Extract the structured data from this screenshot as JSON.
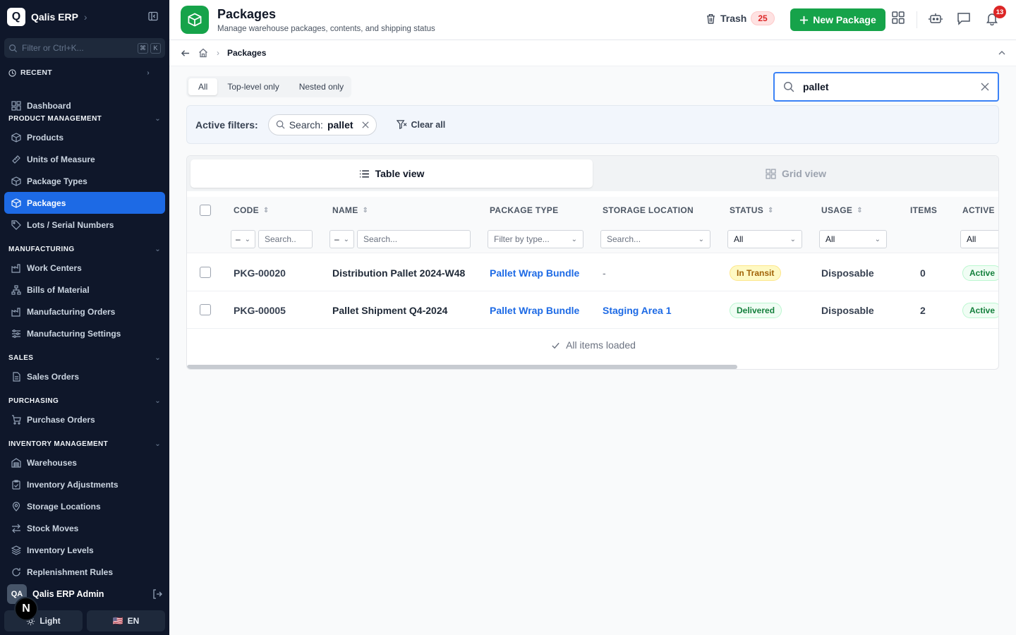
{
  "app": {
    "logo_letter": "Q",
    "name": "Qalis ERP"
  },
  "sidebar": {
    "search_placeholder": "Filter or Ctrl+K...",
    "kbd": [
      "⌘",
      "K"
    ],
    "recent_label": "RECENT",
    "dashboard": "Dashboard",
    "sections": [
      {
        "title": "PRODUCT MANAGEMENT",
        "items": [
          "Products",
          "Units of Measure",
          "Package Types",
          "Packages",
          "Lots / Serial Numbers"
        ]
      },
      {
        "title": "MANUFACTURING",
        "items": [
          "Work Centers",
          "Bills of Material",
          "Manufacturing Orders",
          "Manufacturing Settings"
        ]
      },
      {
        "title": "SALES",
        "items": [
          "Sales Orders"
        ]
      },
      {
        "title": "PURCHASING",
        "items": [
          "Purchase Orders"
        ]
      },
      {
        "title": "INVENTORY MANAGEMENT",
        "items": [
          "Warehouses",
          "Inventory Adjustments",
          "Storage Locations",
          "Stock Moves",
          "Inventory Levels",
          "Replenishment Rules"
        ]
      }
    ],
    "active_item": "Packages",
    "user": {
      "initials": "QA",
      "name": "Qalis ERP Admin"
    },
    "theme_label": "Light",
    "lang_label": "EN",
    "lang_flag": "🇺🇸",
    "nbadge": "N"
  },
  "header": {
    "title": "Packages",
    "subtitle": "Manage warehouse packages, contents, and shipping status",
    "trash_label": "Trash",
    "trash_count": "25",
    "new_button": "New Package",
    "notif_count": "13"
  },
  "breadcrumb": {
    "current": "Packages"
  },
  "tabs": [
    {
      "label": "All",
      "active": true
    },
    {
      "label": "Top-level only"
    },
    {
      "label": "Nested only"
    }
  ],
  "search": {
    "value": "pallet"
  },
  "filters": {
    "label": "Active filters:",
    "chip_key": "Search:",
    "chip_value": "pallet",
    "clear_label": "Clear all"
  },
  "view_tabs": {
    "table": "Table view",
    "grid": "Grid view"
  },
  "table": {
    "columns": [
      "CODE",
      "NAME",
      "PACKAGE TYPE",
      "STORAGE LOCATION",
      "STATUS",
      "USAGE",
      "ITEMS",
      "ACTIVE"
    ],
    "filters": {
      "code_op": "–",
      "code_placeholder": "Search..",
      "name_op": "–",
      "name_placeholder": "Search...",
      "type_placeholder": "Filter by type...",
      "location_placeholder": "Search...",
      "status_value": "All",
      "usage_value": "All",
      "active_value": "All"
    },
    "rows": [
      {
        "code": "PKG-00020",
        "name": "Distribution Pallet 2024-W48",
        "type": "Pallet Wrap Bundle",
        "location": "-",
        "status": "In Transit",
        "usage": "Disposable",
        "items": "0",
        "active": "Active"
      },
      {
        "code": "PKG-00005",
        "name": "Pallet Shipment Q4-2024",
        "type": "Pallet Wrap Bundle",
        "location": "Staging Area 1",
        "status": "Delivered",
        "usage": "Disposable",
        "items": "2",
        "active": "Active"
      }
    ],
    "footer": "All items loaded"
  },
  "colors": {
    "sidebar_bg": "#0f172a",
    "active_blue": "#1d6ae5",
    "brand_green": "#16a34a"
  }
}
